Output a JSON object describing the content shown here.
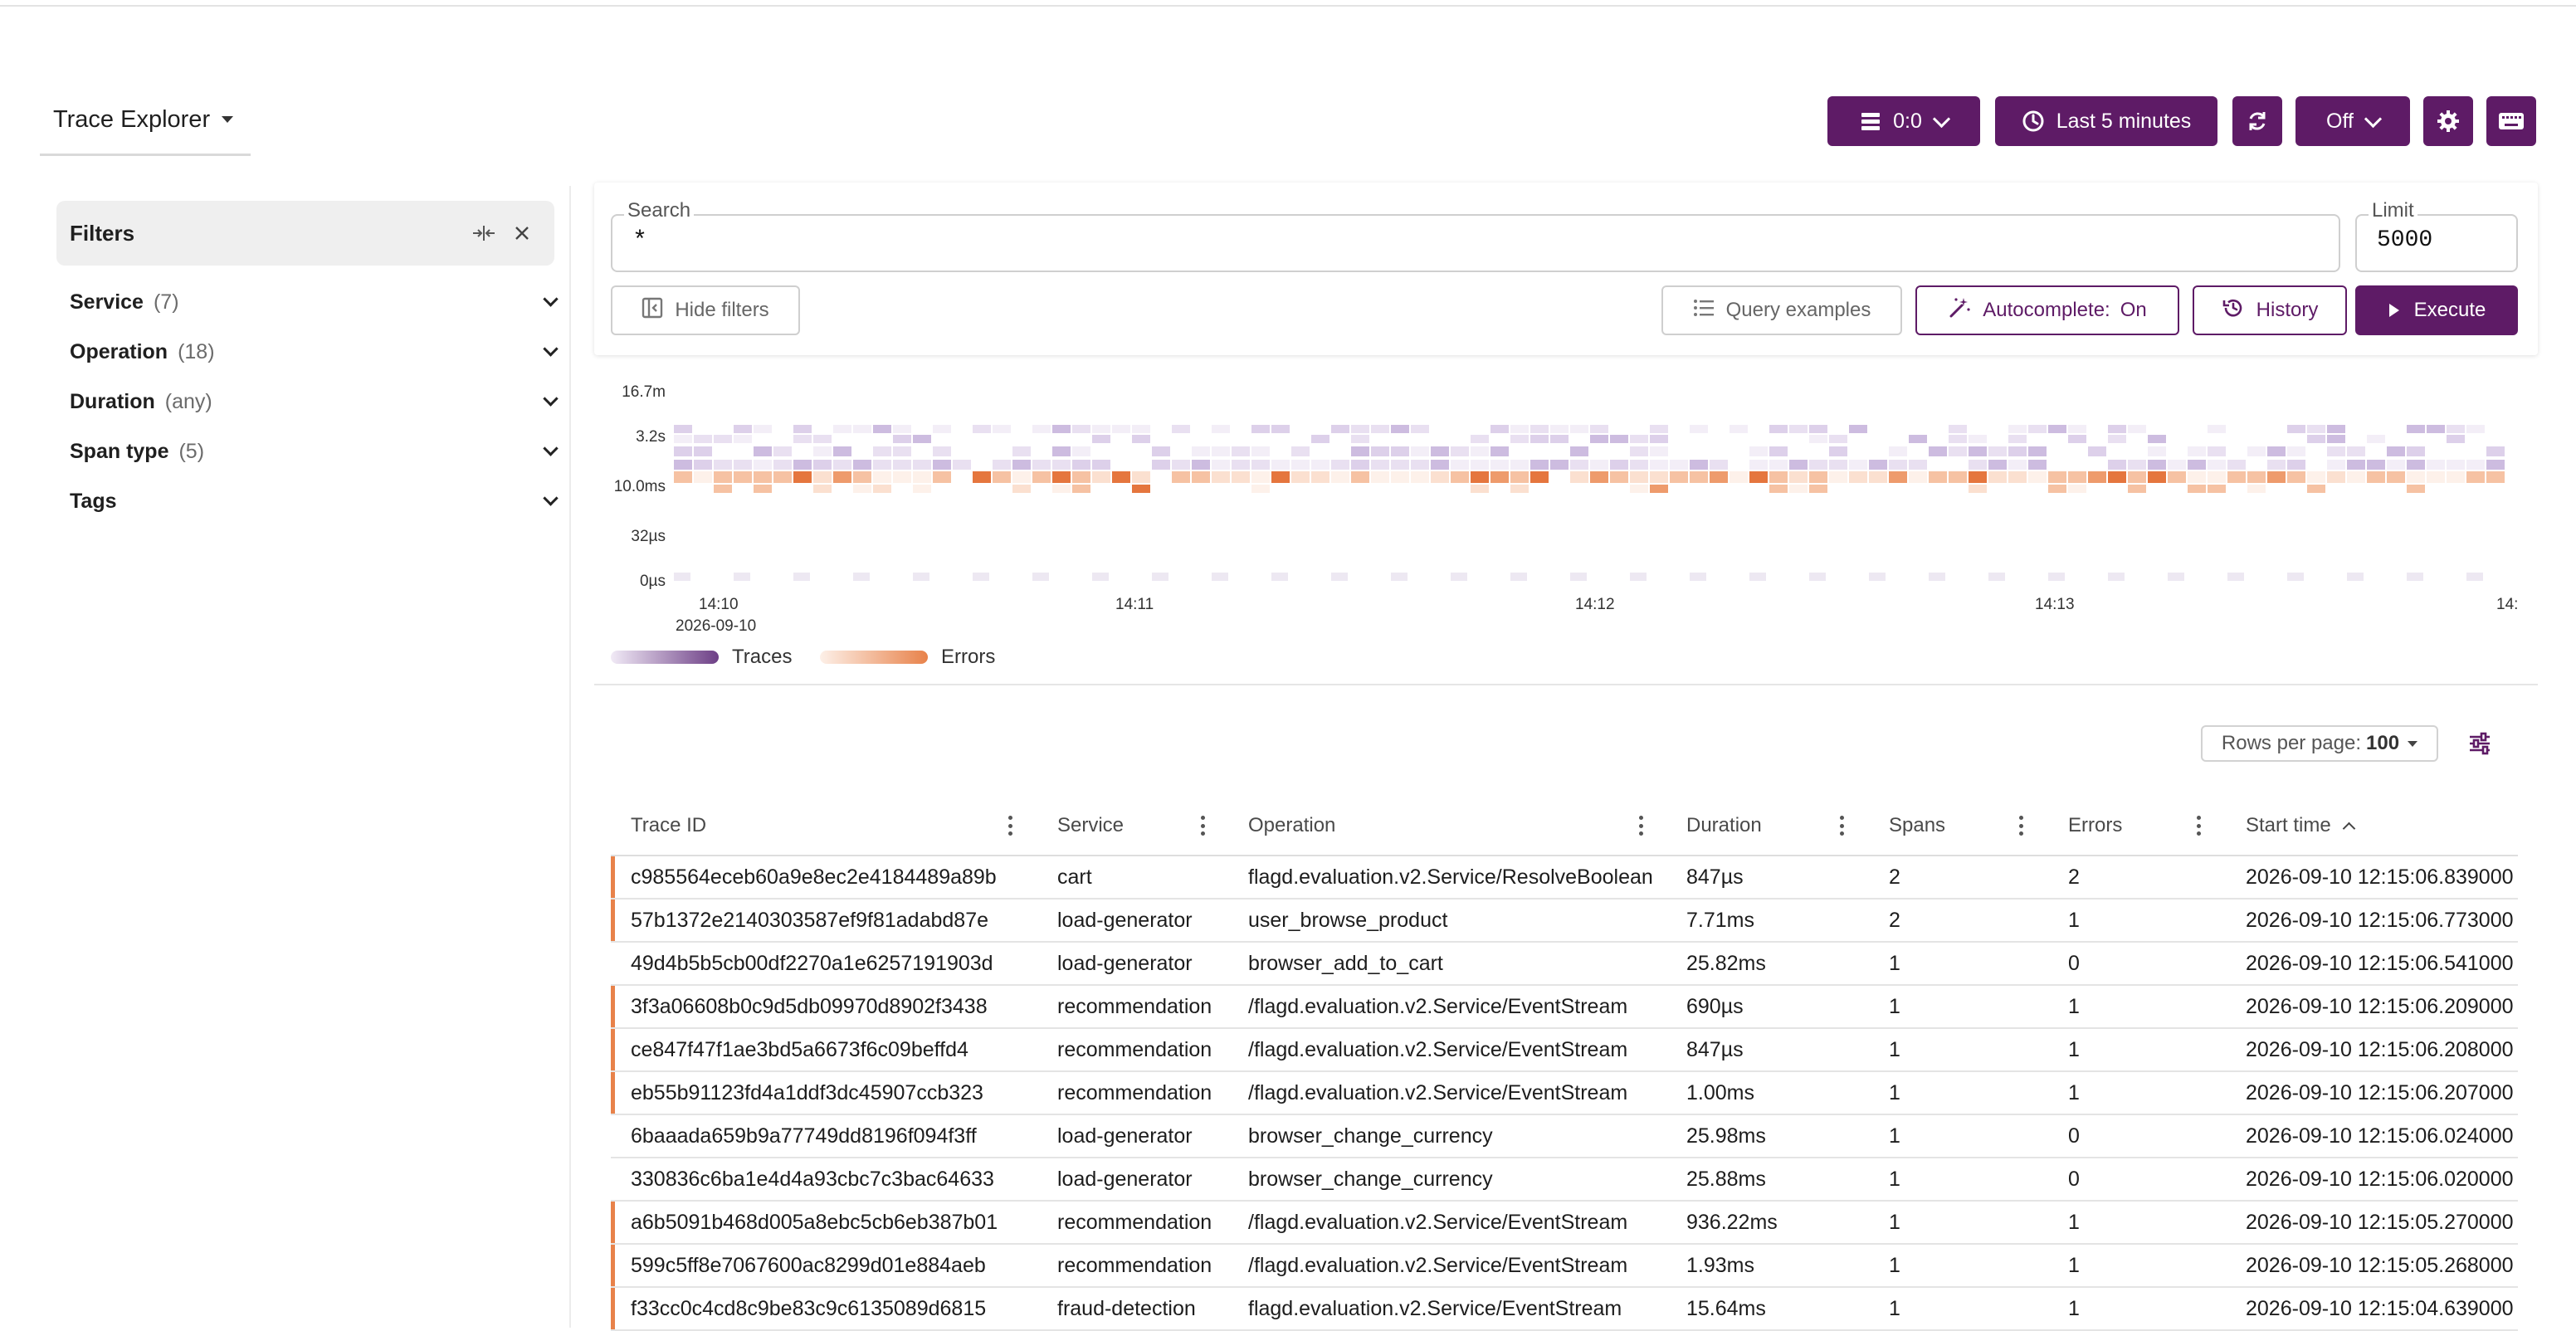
{
  "app": {
    "title": "Trace Explorer"
  },
  "toolbar": {
    "datasource_label": "0:0",
    "time_range_label": "Last 5 minutes",
    "auto_refresh_label": "Off"
  },
  "filters": {
    "title": "Filters",
    "items": [
      {
        "label": "Service",
        "count": "(7)"
      },
      {
        "label": "Operation",
        "count": "(18)"
      },
      {
        "label": "Duration",
        "count": "(any)"
      },
      {
        "label": "Span type",
        "count": "(5)"
      },
      {
        "label": "Tags",
        "count": ""
      }
    ]
  },
  "search": {
    "label": "Search",
    "value": "*",
    "limit_label": "Limit",
    "limit_value": "5000",
    "hide_filters_label": "Hide filters",
    "query_examples_label": "Query examples",
    "autocomplete_label": "Autocomplete:",
    "autocomplete_state": "On",
    "history_label": "History",
    "execute_label": "Execute"
  },
  "colors": {
    "accent": "#5e1b66",
    "traces": "#6d3f86",
    "errors": "#e8824a"
  },
  "chart_data": {
    "type": "heatmap",
    "y_ticks": [
      "16.7m",
      "3.2s",
      "10.0ms",
      "32µs",
      "0µs"
    ],
    "x_ticks": [
      {
        "label": "14:10",
        "sub": "2026-09-10"
      },
      {
        "label": "14:11",
        "sub": ""
      },
      {
        "label": "14:12",
        "sub": ""
      },
      {
        "label": "14:13",
        "sub": ""
      },
      {
        "label": "14:",
        "sub": ""
      }
    ],
    "legend": [
      "Traces",
      "Errors"
    ]
  },
  "table": {
    "rows_per_page_label": "Rows per page:",
    "rows_per_page_value": "100",
    "columns": [
      "Trace ID",
      "Service",
      "Operation",
      "Duration",
      "Spans",
      "Errors",
      "Start time"
    ],
    "rows": [
      {
        "trace_id": "c985564eceb60a9e8ec2e4184489a89b",
        "service": "cart",
        "operation": "flagd.evaluation.v2.Service/ResolveBoolean",
        "duration": "847µs",
        "spans": "2",
        "errors": "2",
        "start": "2026-09-10 12:15:06.839000",
        "has_error": true
      },
      {
        "trace_id": "57b1372e2140303587ef9f81adabd87e",
        "service": "load-generator",
        "operation": "user_browse_product",
        "duration": "7.71ms",
        "spans": "2",
        "errors": "1",
        "start": "2026-09-10 12:15:06.773000",
        "has_error": true
      },
      {
        "trace_id": "49d4b5b5cb00df2270a1e6257191903d",
        "service": "load-generator",
        "operation": "browser_add_to_cart",
        "duration": "25.82ms",
        "spans": "1",
        "errors": "0",
        "start": "2026-09-10 12:15:06.541000",
        "has_error": false
      },
      {
        "trace_id": "3f3a06608b0c9d5db09970d8902f3438",
        "service": "recommendation",
        "operation": "/flagd.evaluation.v2.Service/EventStream",
        "duration": "690µs",
        "spans": "1",
        "errors": "1",
        "start": "2026-09-10 12:15:06.209000",
        "has_error": true
      },
      {
        "trace_id": "ce847f47f1ae3bd5a6673f6c09beffd4",
        "service": "recommendation",
        "operation": "/flagd.evaluation.v2.Service/EventStream",
        "duration": "847µs",
        "spans": "1",
        "errors": "1",
        "start": "2026-09-10 12:15:06.208000",
        "has_error": true
      },
      {
        "trace_id": "eb55b91123fd4a1ddf3dc45907ccb323",
        "service": "recommendation",
        "operation": "/flagd.evaluation.v2.Service/EventStream",
        "duration": "1.00ms",
        "spans": "1",
        "errors": "1",
        "start": "2026-09-10 12:15:06.207000",
        "has_error": true
      },
      {
        "trace_id": "6baaada659b9a77749dd8196f094f3ff",
        "service": "load-generator",
        "operation": "browser_change_currency",
        "duration": "25.98ms",
        "spans": "1",
        "errors": "0",
        "start": "2026-09-10 12:15:06.024000",
        "has_error": false
      },
      {
        "trace_id": "330836c6ba1e4d4a93cbc7c3bac64633",
        "service": "load-generator",
        "operation": "browser_change_currency",
        "duration": "25.88ms",
        "spans": "1",
        "errors": "0",
        "start": "2026-09-10 12:15:06.020000",
        "has_error": false
      },
      {
        "trace_id": "a6b5091b468d005a8ebc5cb6eb387b01",
        "service": "recommendation",
        "operation": "/flagd.evaluation.v2.Service/EventStream",
        "duration": "936.22ms",
        "spans": "1",
        "errors": "1",
        "start": "2026-09-10 12:15:05.270000",
        "has_error": true
      },
      {
        "trace_id": "599c5ff8e7067600ac8299d01e884aeb",
        "service": "recommendation",
        "operation": "/flagd.evaluation.v2.Service/EventStream",
        "duration": "1.93ms",
        "spans": "1",
        "errors": "1",
        "start": "2026-09-10 12:15:05.268000",
        "has_error": true
      },
      {
        "trace_id": "f33cc0c4cd8c9be83c9c6135089d6815",
        "service": "fraud-detection",
        "operation": "flagd.evaluation.v2.Service/EventStream",
        "duration": "15.64ms",
        "spans": "1",
        "errors": "1",
        "start": "2026-09-10 12:15:04.639000",
        "has_error": true
      }
    ]
  }
}
